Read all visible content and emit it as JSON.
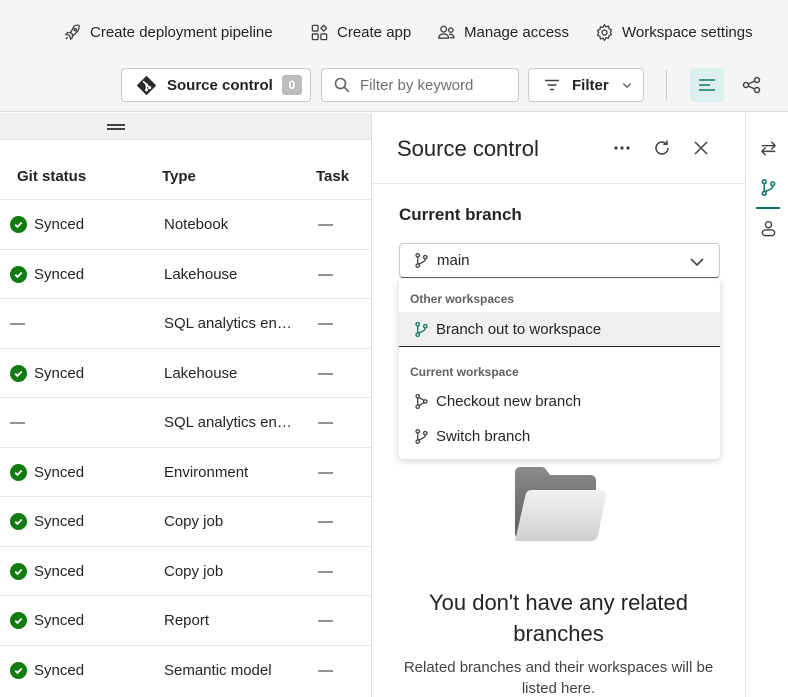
{
  "toolbar": {
    "create_pipeline": "Create deployment pipeline",
    "create_app": "Create app",
    "manage_access": "Manage access",
    "workspace_settings": "Workspace settings",
    "source_control_label": "Source control",
    "source_control_count": "0",
    "filter_placeholder": "Filter by keyword",
    "filter_label": "Filter"
  },
  "table": {
    "headers": {
      "git_status": "Git status",
      "type": "Type",
      "task": "Task"
    },
    "rows": [
      {
        "status": "Synced",
        "synced": true,
        "type": "Notebook",
        "task": "—"
      },
      {
        "status": "Synced",
        "synced": true,
        "type": "Lakehouse",
        "task": "—"
      },
      {
        "status": "—",
        "synced": false,
        "type": "SQL analytics endpoint",
        "task": "—"
      },
      {
        "status": "Synced",
        "synced": true,
        "type": "Lakehouse",
        "task": "—"
      },
      {
        "status": "—",
        "synced": false,
        "type": "SQL analytics endpoint",
        "task": "—"
      },
      {
        "status": "Synced",
        "synced": true,
        "type": "Environment",
        "task": "—"
      },
      {
        "status": "Synced",
        "synced": true,
        "type": "Copy job",
        "task": "—"
      },
      {
        "status": "Synced",
        "synced": true,
        "type": "Copy job",
        "task": "—"
      },
      {
        "status": "Synced",
        "synced": true,
        "type": "Report",
        "task": "—"
      },
      {
        "status": "Synced",
        "synced": true,
        "type": "Semantic model",
        "task": "—"
      }
    ]
  },
  "pane": {
    "title": "Source control",
    "current_branch_label": "Current branch",
    "current_branch": "main",
    "dropdown": {
      "group_other": "Other workspaces",
      "branch_out": "Branch out to workspace",
      "group_current": "Current workspace",
      "checkout_new": "Checkout new branch",
      "switch_branch": "Switch branch"
    },
    "empty_title": "You don't have any related branches",
    "empty_desc": "Related branches and their workspaces will be listed here."
  },
  "colors": {
    "accent": "#117865",
    "synced_green": "#107c10",
    "topbar_bg": "#f5f5f5"
  },
  "icons": {
    "pipeline": "rocket-icon",
    "app": "app-icon",
    "access": "people-icon",
    "settings": "gear-icon",
    "git": "git-logo-icon",
    "search": "search-icon",
    "filter": "filter-icon",
    "list_view": "list-view-icon",
    "lineage_view": "lineage-icon",
    "branch": "branch-icon",
    "folder": "folder-icon"
  }
}
